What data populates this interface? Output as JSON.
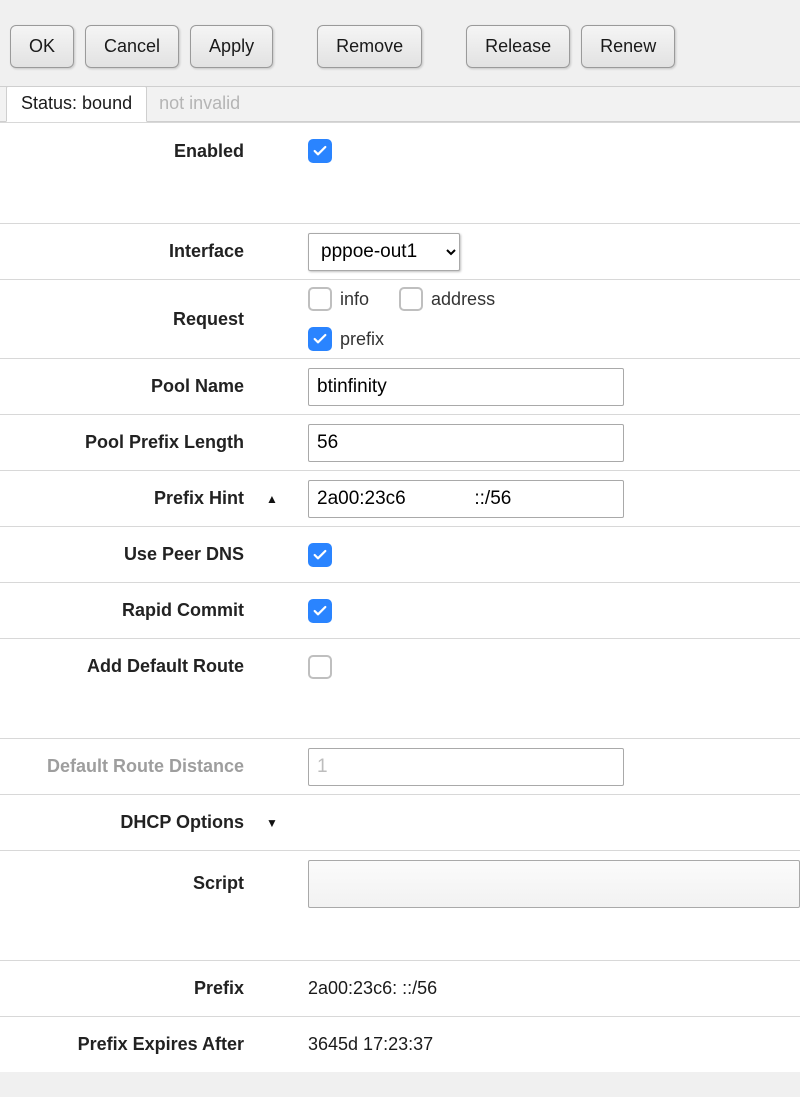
{
  "buttons": {
    "ok": "OK",
    "cancel": "Cancel",
    "apply": "Apply",
    "remove": "Remove",
    "release": "Release",
    "renew": "Renew"
  },
  "status": {
    "label": "Status: bound",
    "note": "not invalid"
  },
  "labels": {
    "enabled": "Enabled",
    "interface": "Interface",
    "request": "Request",
    "pool_name": "Pool Name",
    "pool_prefix_length": "Pool Prefix Length",
    "prefix_hint": "Prefix Hint",
    "use_peer_dns": "Use Peer DNS",
    "rapid_commit": "Rapid Commit",
    "add_default_route": "Add Default Route",
    "default_route_distance": "Default Route Distance",
    "dhcp_options": "DHCP Options",
    "script": "Script",
    "prefix": "Prefix",
    "prefix_expires_after": "Prefix Expires After"
  },
  "values": {
    "enabled": true,
    "interface": "pppoe-out1",
    "request_info": false,
    "request_info_label": "info",
    "request_address": false,
    "request_address_label": "address",
    "request_prefix": true,
    "request_prefix_label": "prefix",
    "pool_name": "btinfinity",
    "pool_prefix_length": "56",
    "prefix_hint": "2a00:23c6             ::/56",
    "use_peer_dns": true,
    "rapid_commit": true,
    "add_default_route": false,
    "default_route_distance": "1",
    "script": "",
    "prefix": "2a00:23c6:            ::/56",
    "prefix_expires_after": "3645d 17:23:37"
  },
  "icons": {
    "triangle_up": "▲",
    "triangle_down": "▼"
  }
}
